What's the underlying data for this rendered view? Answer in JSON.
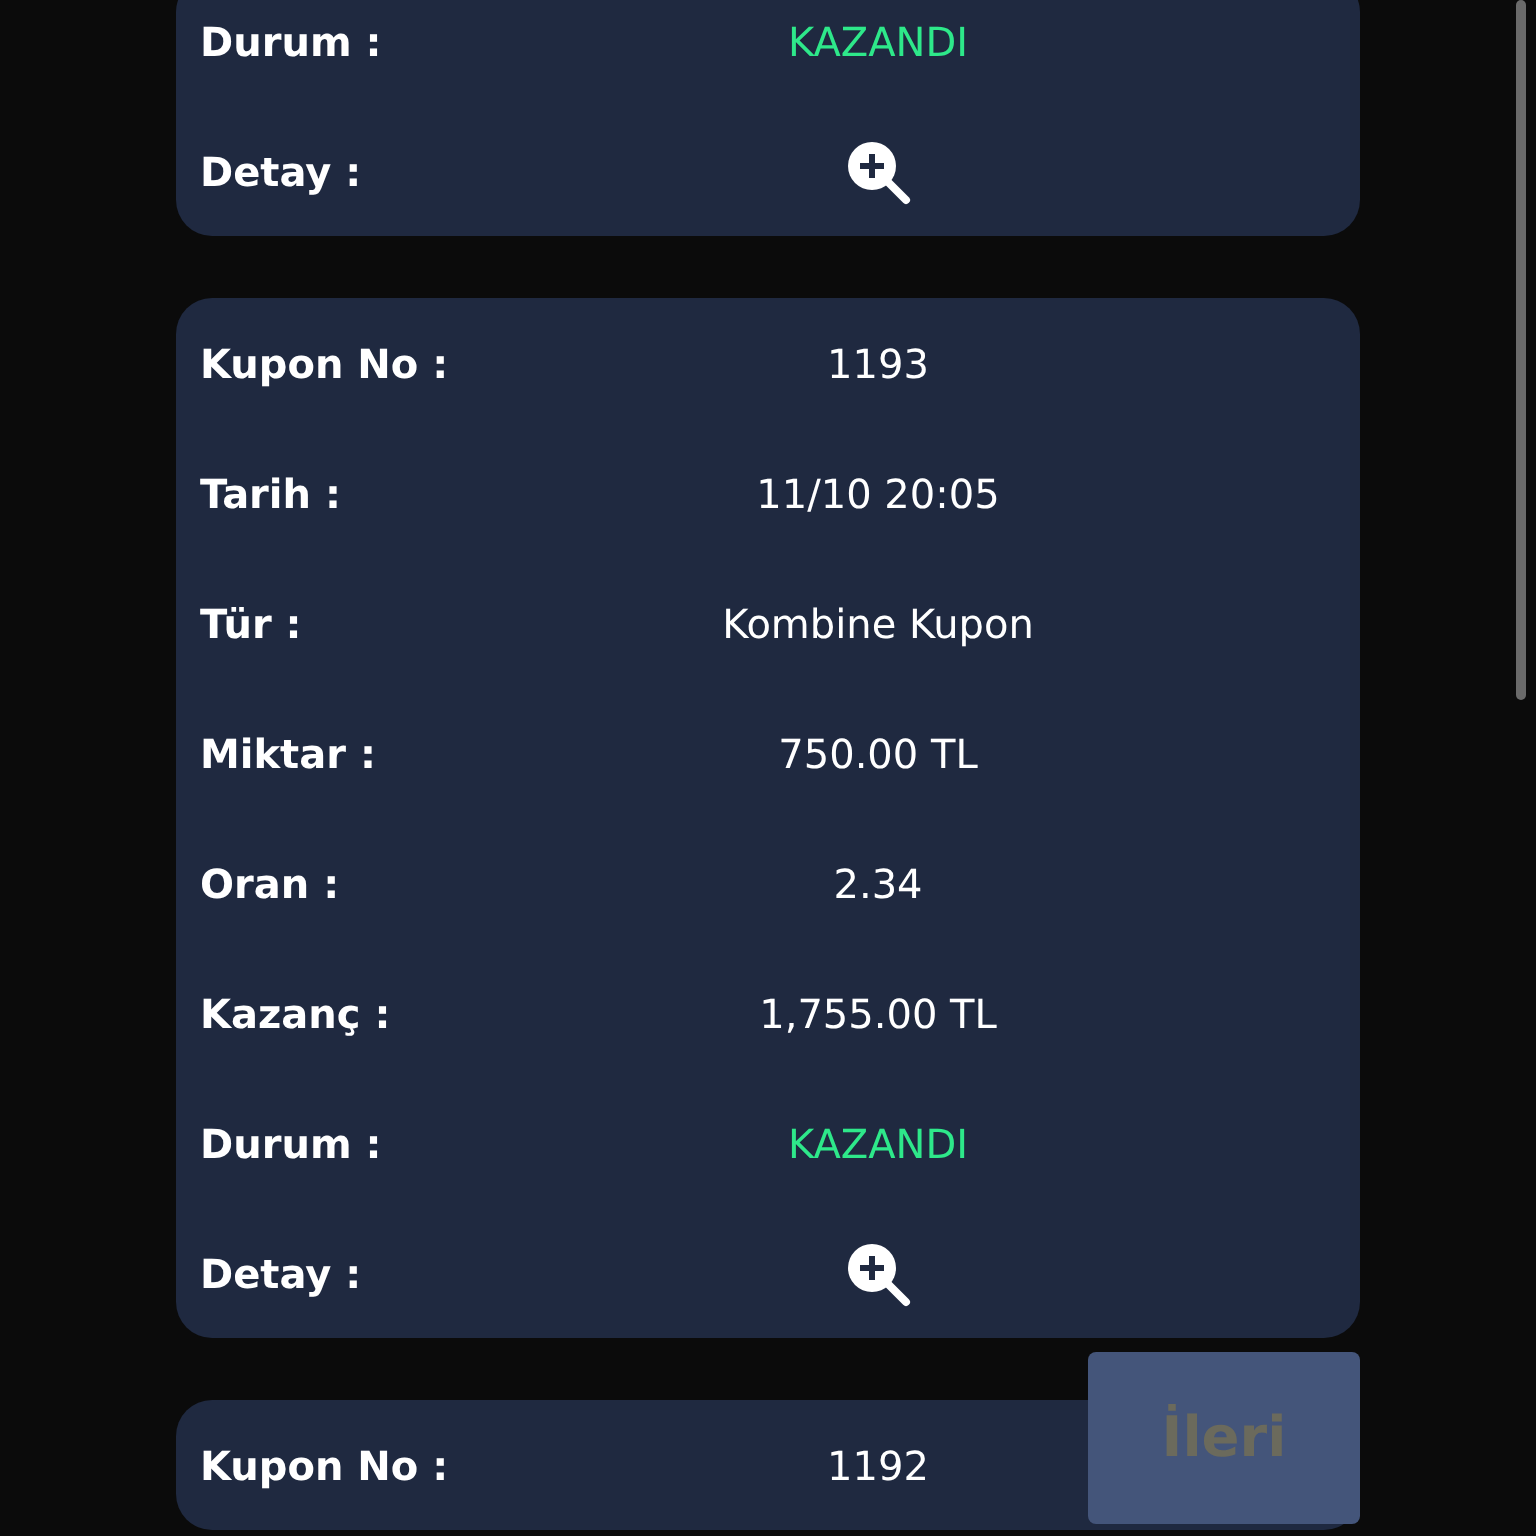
{
  "coupons": [
    {
      "rows": [
        {
          "kind": "status",
          "label": "Durum :",
          "value": "KAZANDI"
        },
        {
          "kind": "detail",
          "label": "Detay :"
        }
      ]
    },
    {
      "rows": [
        {
          "kind": "text",
          "label": "Kupon No :",
          "value": "1193"
        },
        {
          "kind": "text",
          "label": "Tarih :",
          "value": "11/10 20:05"
        },
        {
          "kind": "text",
          "label": "Tür :",
          "value": "Kombine Kupon"
        },
        {
          "kind": "text",
          "label": "Miktar :",
          "value": "750.00 TL"
        },
        {
          "kind": "text",
          "label": "Oran :",
          "value": "2.34"
        },
        {
          "kind": "text",
          "label": "Kazanç :",
          "value": "1,755.00 TL"
        },
        {
          "kind": "status",
          "label": "Durum :",
          "value": "KAZANDI"
        },
        {
          "kind": "detail",
          "label": "Detay :"
        }
      ]
    },
    {
      "rows": [
        {
          "kind": "text",
          "label": "Kupon No :",
          "value": "1192"
        }
      ]
    }
  ],
  "next_button": {
    "label": "İleri",
    "disabled": true
  }
}
